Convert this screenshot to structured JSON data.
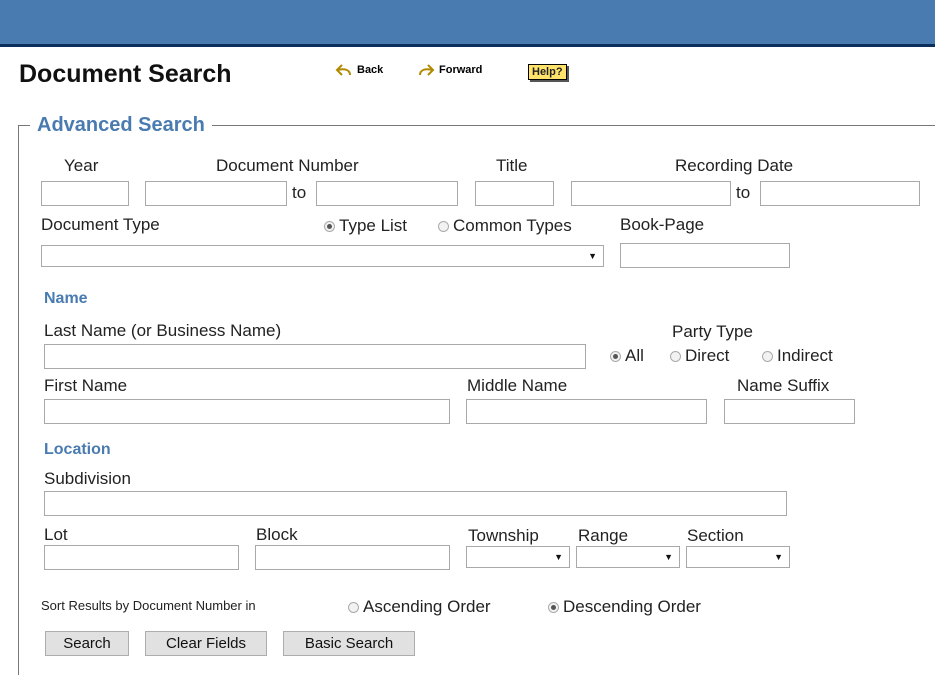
{
  "header": {
    "title": "Document Search",
    "back_label": "Back",
    "forward_label": "Forward",
    "help_label": "Help?"
  },
  "advanced": {
    "legend": "Advanced Search",
    "year_label": "Year",
    "docnum_label": "Document Number",
    "to_label": "to",
    "title_label": "Title",
    "recdate_label": "Recording Date",
    "doctype_label": "Document Type",
    "doctype_mode": {
      "options": [
        "Type List",
        "Common Types"
      ],
      "selected": "Type List"
    },
    "bookpage_label": "Book-Page"
  },
  "name": {
    "section_label": "Name",
    "last_name_label": "Last Name (or Business Name)",
    "party_type_label": "Party Type",
    "party_type": {
      "options": [
        "All",
        "Direct",
        "Indirect"
      ],
      "selected": "All"
    },
    "first_name_label": "First Name",
    "middle_name_label": "Middle Name",
    "suffix_label": "Name Suffix"
  },
  "location": {
    "section_label": "Location",
    "subdivision_label": "Subdivision",
    "lot_label": "Lot",
    "block_label": "Block",
    "township_label": "Township",
    "range_label": "Range",
    "section_label2": "Section"
  },
  "sort": {
    "label": "Sort Results by Document Number in",
    "options": [
      "Ascending Order",
      "Descending Order"
    ],
    "selected": "Descending Order"
  },
  "buttons": {
    "search": "Search",
    "clear": "Clear Fields",
    "basic": "Basic Search"
  }
}
